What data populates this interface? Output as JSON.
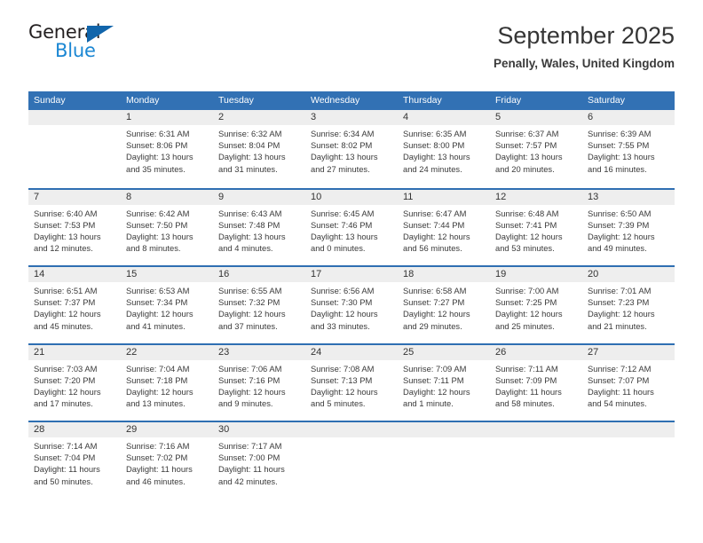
{
  "brand": {
    "name_part1": "General",
    "name_part2": "Blue",
    "triangle_color": "#1165ab",
    "blue_color": "#1b87d3"
  },
  "header": {
    "title": "September 2025",
    "subtitle": "Penally, Wales, United Kingdom"
  },
  "theme": {
    "header_blue": "#3271b4",
    "divider_blue": "#2f6fb2",
    "daynum_band": "#eeeeee",
    "text": "#3a3a3a"
  },
  "weekdays": [
    "Sunday",
    "Monday",
    "Tuesday",
    "Wednesday",
    "Thursday",
    "Friday",
    "Saturday"
  ],
  "weeks": [
    [
      {
        "day": "",
        "lines": []
      },
      {
        "day": "1",
        "lines": [
          "Sunrise: 6:31 AM",
          "Sunset: 8:06 PM",
          "Daylight: 13 hours",
          "and 35 minutes."
        ]
      },
      {
        "day": "2",
        "lines": [
          "Sunrise: 6:32 AM",
          "Sunset: 8:04 PM",
          "Daylight: 13 hours",
          "and 31 minutes."
        ]
      },
      {
        "day": "3",
        "lines": [
          "Sunrise: 6:34 AM",
          "Sunset: 8:02 PM",
          "Daylight: 13 hours",
          "and 27 minutes."
        ]
      },
      {
        "day": "4",
        "lines": [
          "Sunrise: 6:35 AM",
          "Sunset: 8:00 PM",
          "Daylight: 13 hours",
          "and 24 minutes."
        ]
      },
      {
        "day": "5",
        "lines": [
          "Sunrise: 6:37 AM",
          "Sunset: 7:57 PM",
          "Daylight: 13 hours",
          "and 20 minutes."
        ]
      },
      {
        "day": "6",
        "lines": [
          "Sunrise: 6:39 AM",
          "Sunset: 7:55 PM",
          "Daylight: 13 hours",
          "and 16 minutes."
        ]
      }
    ],
    [
      {
        "day": "7",
        "lines": [
          "Sunrise: 6:40 AM",
          "Sunset: 7:53 PM",
          "Daylight: 13 hours",
          "and 12 minutes."
        ]
      },
      {
        "day": "8",
        "lines": [
          "Sunrise: 6:42 AM",
          "Sunset: 7:50 PM",
          "Daylight: 13 hours",
          "and 8 minutes."
        ]
      },
      {
        "day": "9",
        "lines": [
          "Sunrise: 6:43 AM",
          "Sunset: 7:48 PM",
          "Daylight: 13 hours",
          "and 4 minutes."
        ]
      },
      {
        "day": "10",
        "lines": [
          "Sunrise: 6:45 AM",
          "Sunset: 7:46 PM",
          "Daylight: 13 hours",
          "and 0 minutes."
        ]
      },
      {
        "day": "11",
        "lines": [
          "Sunrise: 6:47 AM",
          "Sunset: 7:44 PM",
          "Daylight: 12 hours",
          "and 56 minutes."
        ]
      },
      {
        "day": "12",
        "lines": [
          "Sunrise: 6:48 AM",
          "Sunset: 7:41 PM",
          "Daylight: 12 hours",
          "and 53 minutes."
        ]
      },
      {
        "day": "13",
        "lines": [
          "Sunrise: 6:50 AM",
          "Sunset: 7:39 PM",
          "Daylight: 12 hours",
          "and 49 minutes."
        ]
      }
    ],
    [
      {
        "day": "14",
        "lines": [
          "Sunrise: 6:51 AM",
          "Sunset: 7:37 PM",
          "Daylight: 12 hours",
          "and 45 minutes."
        ]
      },
      {
        "day": "15",
        "lines": [
          "Sunrise: 6:53 AM",
          "Sunset: 7:34 PM",
          "Daylight: 12 hours",
          "and 41 minutes."
        ]
      },
      {
        "day": "16",
        "lines": [
          "Sunrise: 6:55 AM",
          "Sunset: 7:32 PM",
          "Daylight: 12 hours",
          "and 37 minutes."
        ]
      },
      {
        "day": "17",
        "lines": [
          "Sunrise: 6:56 AM",
          "Sunset: 7:30 PM",
          "Daylight: 12 hours",
          "and 33 minutes."
        ]
      },
      {
        "day": "18",
        "lines": [
          "Sunrise: 6:58 AM",
          "Sunset: 7:27 PM",
          "Daylight: 12 hours",
          "and 29 minutes."
        ]
      },
      {
        "day": "19",
        "lines": [
          "Sunrise: 7:00 AM",
          "Sunset: 7:25 PM",
          "Daylight: 12 hours",
          "and 25 minutes."
        ]
      },
      {
        "day": "20",
        "lines": [
          "Sunrise: 7:01 AM",
          "Sunset: 7:23 PM",
          "Daylight: 12 hours",
          "and 21 minutes."
        ]
      }
    ],
    [
      {
        "day": "21",
        "lines": [
          "Sunrise: 7:03 AM",
          "Sunset: 7:20 PM",
          "Daylight: 12 hours",
          "and 17 minutes."
        ]
      },
      {
        "day": "22",
        "lines": [
          "Sunrise: 7:04 AM",
          "Sunset: 7:18 PM",
          "Daylight: 12 hours",
          "and 13 minutes."
        ]
      },
      {
        "day": "23",
        "lines": [
          "Sunrise: 7:06 AM",
          "Sunset: 7:16 PM",
          "Daylight: 12 hours",
          "and 9 minutes."
        ]
      },
      {
        "day": "24",
        "lines": [
          "Sunrise: 7:08 AM",
          "Sunset: 7:13 PM",
          "Daylight: 12 hours",
          "and 5 minutes."
        ]
      },
      {
        "day": "25",
        "lines": [
          "Sunrise: 7:09 AM",
          "Sunset: 7:11 PM",
          "Daylight: 12 hours",
          "and 1 minute."
        ]
      },
      {
        "day": "26",
        "lines": [
          "Sunrise: 7:11 AM",
          "Sunset: 7:09 PM",
          "Daylight: 11 hours",
          "and 58 minutes."
        ]
      },
      {
        "day": "27",
        "lines": [
          "Sunrise: 7:12 AM",
          "Sunset: 7:07 PM",
          "Daylight: 11 hours",
          "and 54 minutes."
        ]
      }
    ],
    [
      {
        "day": "28",
        "lines": [
          "Sunrise: 7:14 AM",
          "Sunset: 7:04 PM",
          "Daylight: 11 hours",
          "and 50 minutes."
        ]
      },
      {
        "day": "29",
        "lines": [
          "Sunrise: 7:16 AM",
          "Sunset: 7:02 PM",
          "Daylight: 11 hours",
          "and 46 minutes."
        ]
      },
      {
        "day": "30",
        "lines": [
          "Sunrise: 7:17 AM",
          "Sunset: 7:00 PM",
          "Daylight: 11 hours",
          "and 42 minutes."
        ]
      },
      {
        "day": "",
        "lines": []
      },
      {
        "day": "",
        "lines": []
      },
      {
        "day": "",
        "lines": []
      },
      {
        "day": "",
        "lines": []
      }
    ]
  ]
}
